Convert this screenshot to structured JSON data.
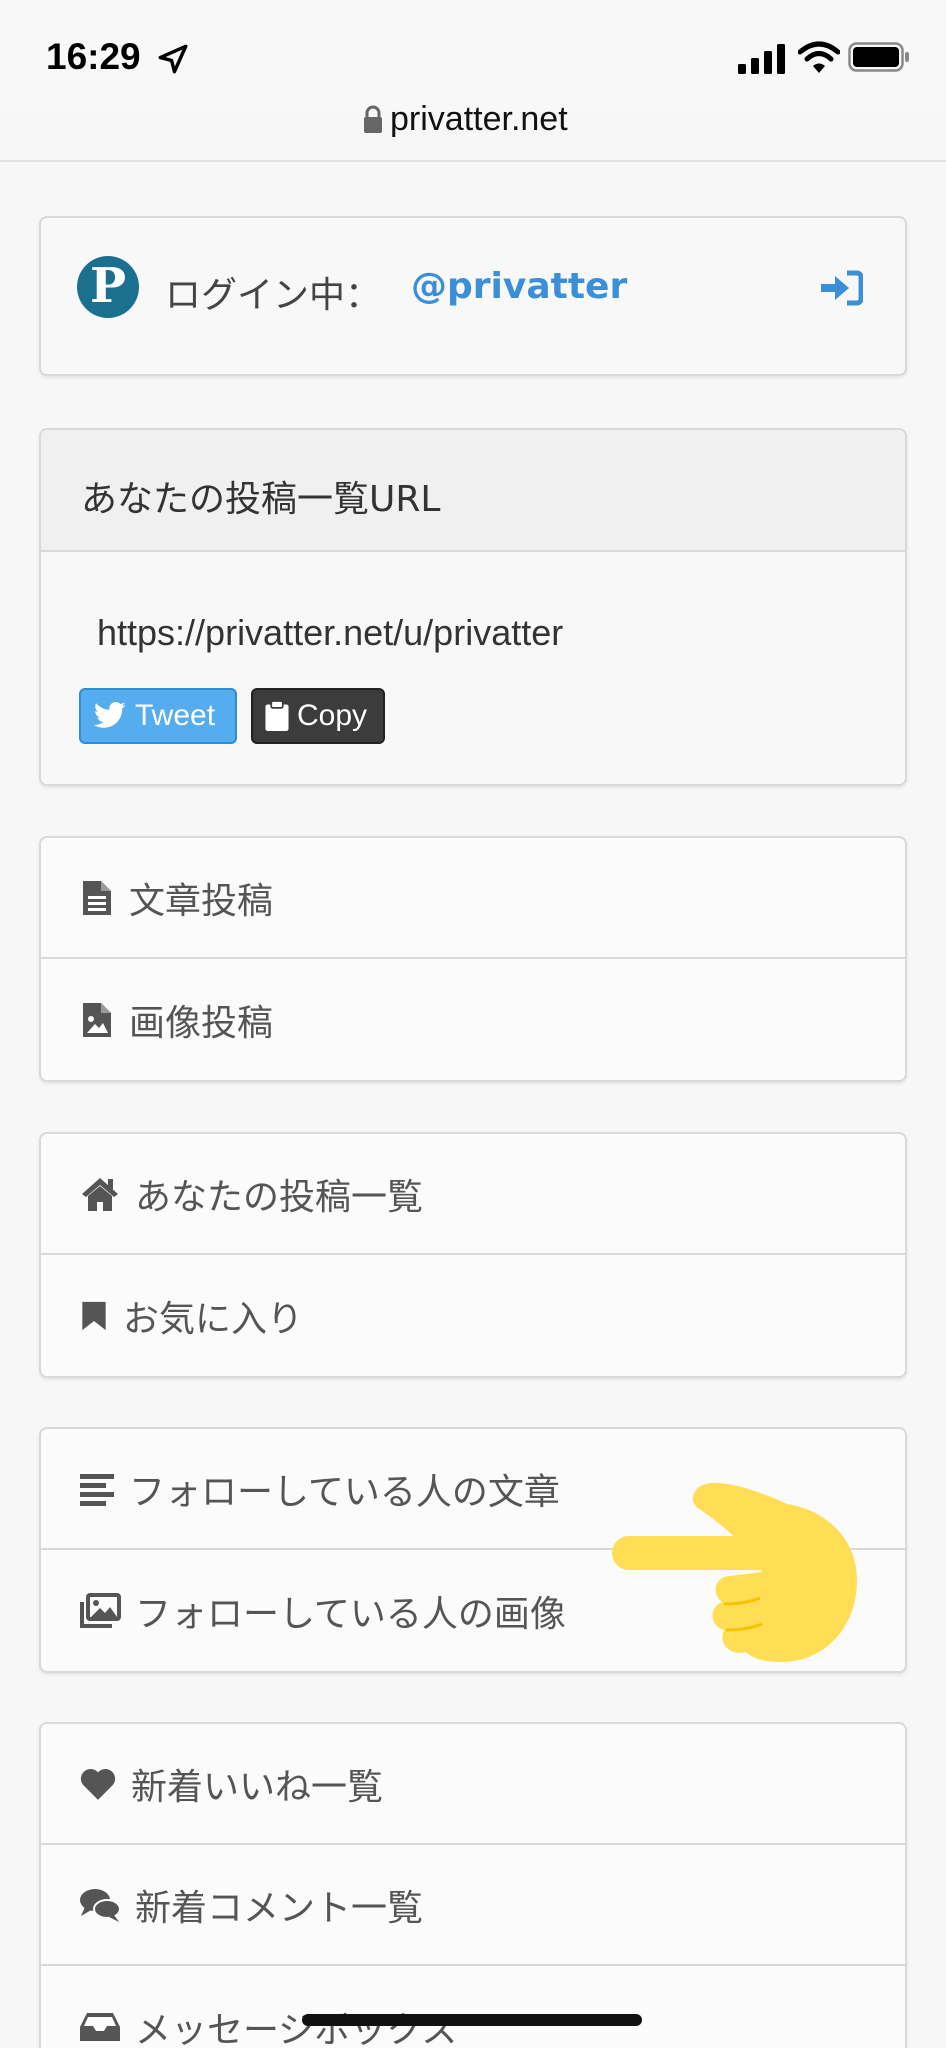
{
  "status_bar": {
    "time": "16:29"
  },
  "browser": {
    "url": "privatter.net"
  },
  "login": {
    "avatar_letter": "P",
    "label": "ログイン中：",
    "username": "@privatter"
  },
  "share": {
    "title": "あなたの投稿一覧URL",
    "url": "https://privatter.net/u/privatter",
    "tweet_label": "Tweet",
    "copy_label": "Copy"
  },
  "menu": {
    "post_text": "文章投稿",
    "post_image": "画像投稿",
    "my_posts": "あなたの投稿一覧",
    "favorites": "お気に入り",
    "following_texts": "フォローしている人の文章",
    "following_images": "フォローしている人の画像",
    "new_likes": "新着いいね一覧",
    "new_comments": "新着コメント一覧",
    "message_box": "メッセージボックス"
  },
  "colors": {
    "accent": "#3a8fd8",
    "tweet_button": "#55acee",
    "copy_button": "#3c3c3c",
    "pointer_emoji": "#ffdd55"
  }
}
